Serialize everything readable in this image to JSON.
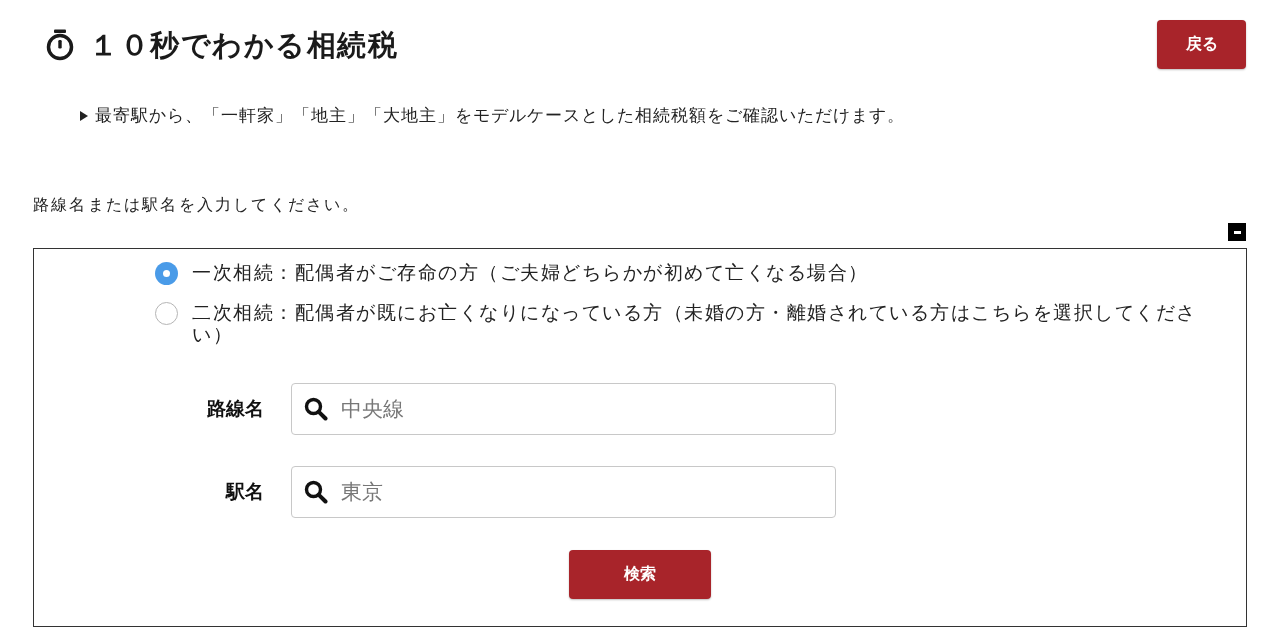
{
  "header": {
    "title": "１０秒でわかる相続税",
    "back_button": "戻る"
  },
  "intro": "最寄駅から、「一軒家」「地主」「大地主」をモデルケースとした相続税額をご確認いただけます。",
  "instruction": "路線名または駅名を入力してください。",
  "panel": {
    "expanded": true,
    "inheritance_options": [
      {
        "label": "一次相続：配偶者がご存命の方（ご夫婦どちらかが初めて亡くなる場合）",
        "selected": true
      },
      {
        "label": "二次相続：配偶者が既にお亡くなりになっている方（未婚の方・離婚されている方はこちらを選択してください）",
        "selected": false
      }
    ],
    "fields": [
      {
        "label": "路線名",
        "placeholder": "中央線"
      },
      {
        "label": "駅名",
        "placeholder": "東京"
      }
    ],
    "search_button": "検索"
  }
}
